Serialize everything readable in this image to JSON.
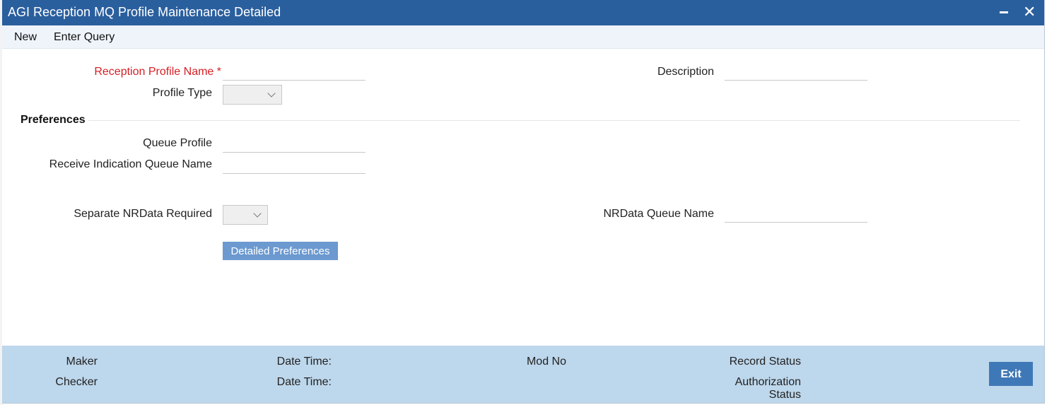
{
  "window": {
    "title": "AGI Reception MQ Profile Maintenance Detailed",
    "minimize_label": "minimize",
    "close_glyph": "✕"
  },
  "menu": {
    "new_label": "New",
    "enter_query_label": "Enter Query"
  },
  "form": {
    "reception_profile_name": {
      "label": "Reception Profile Name",
      "required_marker": "*",
      "value": ""
    },
    "description": {
      "label": "Description",
      "value": ""
    },
    "profile_type": {
      "label": "Profile Type",
      "selected": ""
    },
    "preferences": {
      "section_title": "Preferences",
      "queue_profile": {
        "label": "Queue Profile",
        "value": ""
      },
      "receive_indication_queue_name": {
        "label": "Receive Indication Queue Name",
        "value": ""
      },
      "separate_nrdata_required": {
        "label": "Separate NRData Required",
        "selected": ""
      },
      "nrdata_queue_name": {
        "label": "NRData Queue Name",
        "value": ""
      },
      "detailed_preferences_label": "Detailed Preferences"
    }
  },
  "footer": {
    "maker_label": "Maker",
    "checker_label": "Checker",
    "date_time_label_1": "Date Time:",
    "date_time_label_2": "Date Time:",
    "mod_no_label": "Mod No",
    "record_status_label": "Record Status",
    "authorization_label": "Authorization",
    "status_label": "Status",
    "exit_label": "Exit"
  },
  "colors": {
    "titlebar": "#2a5f9e",
    "required": "#d42026",
    "button": "#6b99d0",
    "footer": "#bdd7ec",
    "exit": "#3f78b6"
  }
}
